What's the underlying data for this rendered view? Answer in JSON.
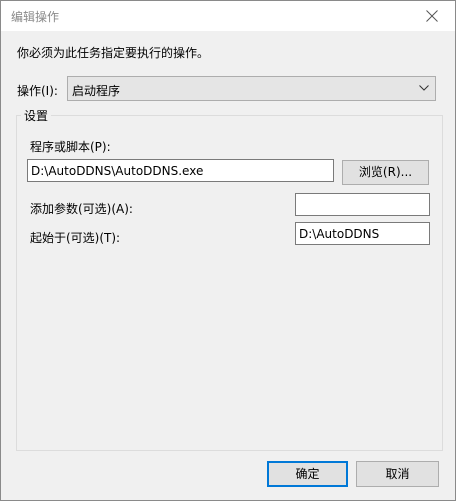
{
  "window": {
    "title": "编辑操作"
  },
  "dialog": {
    "instruction": "你必须为此任务指定要执行的操作。",
    "action_label": "操作(I):",
    "action_value": "启动程序",
    "group_title": "设置",
    "program_label": "程序或脚本(P):",
    "program_value": "D:\\AutoDDNS\\AutoDDNS.exe",
    "browse_label": "浏览(R)...",
    "args_label": "添加参数(可选)(A):",
    "args_value": "",
    "start_in_label": "起始于(可选)(T):",
    "start_in_value": "D:\\AutoDDNS",
    "ok_label": "确定",
    "cancel_label": "取消"
  },
  "icons": {
    "close": "close-icon",
    "dropdown": "chevron-down-icon"
  },
  "colors": {
    "accent": "#0078d7",
    "background": "#f0f0f0",
    "title_text": "#8a8a8a"
  }
}
